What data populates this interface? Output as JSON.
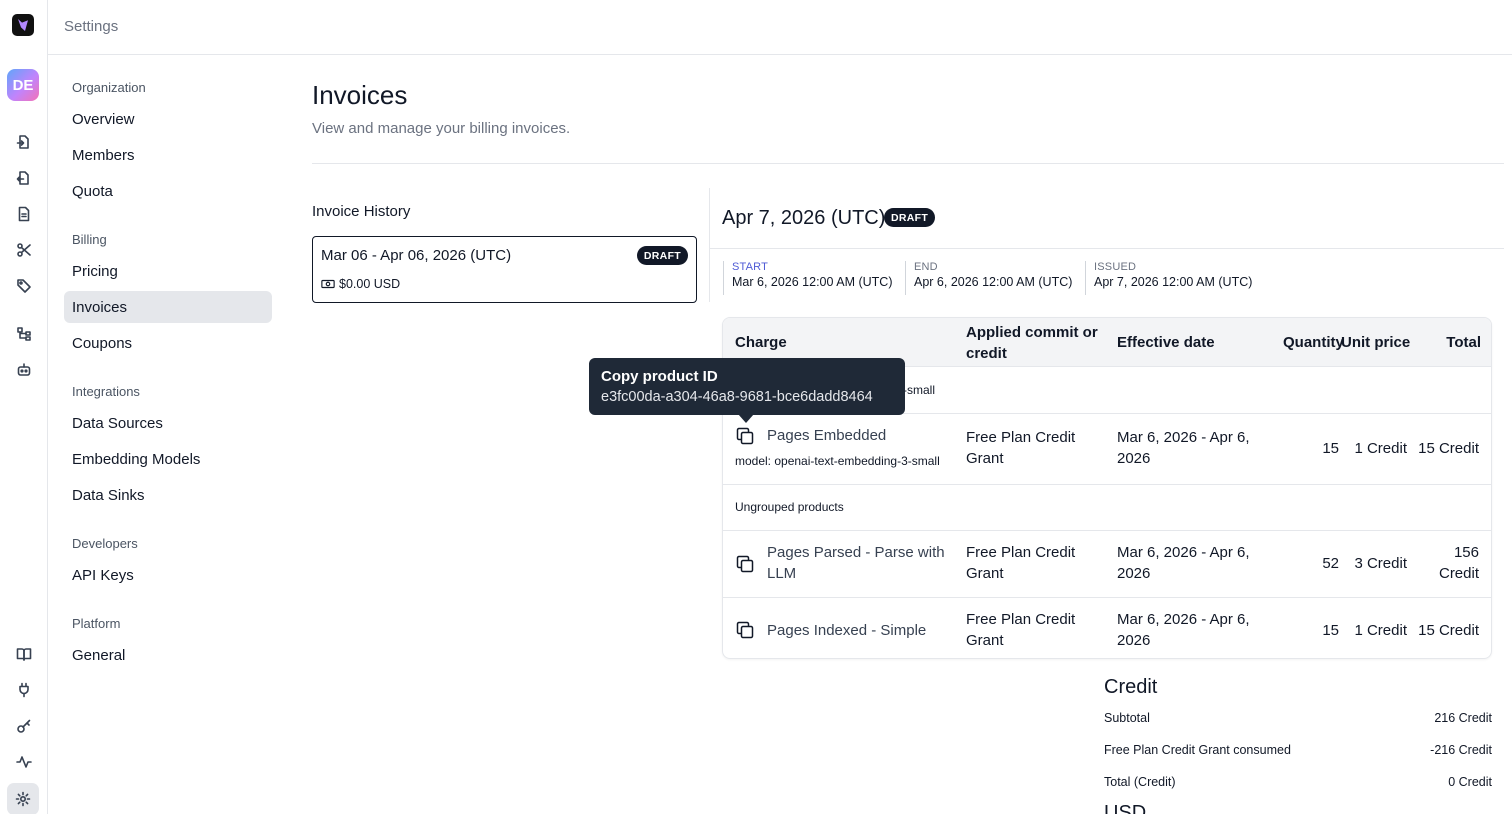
{
  "topbar": {
    "title": "Settings"
  },
  "user": {
    "initials": "DE"
  },
  "nav": {
    "groups": [
      {
        "label": "Organization",
        "items": [
          "Overview",
          "Members",
          "Quota"
        ]
      },
      {
        "label": "Billing",
        "items": [
          "Pricing",
          "Invoices",
          "Coupons"
        ]
      },
      {
        "label": "Integrations",
        "items": [
          "Data Sources",
          "Embedding Models",
          "Data Sinks"
        ]
      },
      {
        "label": "Developers",
        "items": [
          "API Keys"
        ]
      },
      {
        "label": "Platform",
        "items": [
          "General"
        ]
      }
    ],
    "active_item": "Invoices"
  },
  "page": {
    "title": "Invoices",
    "subtitle": "View and manage your billing invoices."
  },
  "history": {
    "title": "Invoice History",
    "invoices": [
      {
        "range": "Mar 06 - Apr 06, 2026 (UTC)",
        "badge": "DRAFT",
        "amount": "$0.00 USD"
      }
    ]
  },
  "detail": {
    "title": "Apr 7, 2026 (UTC)",
    "badge": "DRAFT",
    "meta": [
      {
        "label": "START",
        "value": "Mar 6, 2026 12:00 AM (UTC)"
      },
      {
        "label": "END",
        "value": "Apr 6, 2026 12:00 AM (UTC)"
      },
      {
        "label": "ISSUED",
        "value": "Apr 7, 2026 12:00 AM (UTC)"
      }
    ],
    "table": {
      "headers": {
        "charge": "Charge",
        "applied_line1": "Applied commit or",
        "applied_line2": "credit",
        "effective": "Effective date",
        "quantity": "Quantity",
        "unit_price": "Unit price",
        "total": "Total"
      },
      "group1_label_partial": "-small",
      "rows": [
        {
          "charge": "Pages Embedded",
          "model": "model: openai-text-embedding-3-small",
          "applied_line1": "Free Plan Credit",
          "applied_line2": "Grant",
          "effective_line1": "Mar 6, 2026 - Apr 6,",
          "effective_line2": "2026",
          "quantity": "15",
          "unit_price": "1 Credit",
          "total": "15 Credit"
        },
        {
          "charge_line1": "Pages Parsed - Parse with",
          "charge_line2": "LLM",
          "applied_line1": "Free Plan Credit",
          "applied_line2": "Grant",
          "effective_line1": "Mar 6, 2026 - Apr 6,",
          "effective_line2": "2026",
          "quantity": "52",
          "unit_price": "3 Credit",
          "total_line1": "156",
          "total_line2": "Credit"
        },
        {
          "charge": "Pages Indexed - Simple",
          "applied_line1": "Free Plan Credit",
          "applied_line2": "Grant",
          "effective_line1": "Mar 6, 2026 - Apr 6,",
          "effective_line2": "2026",
          "quantity": "15",
          "unit_price": "1 Credit",
          "total": "15 Credit"
        }
      ],
      "group2_label": "Ungrouped products"
    },
    "tooltip": {
      "title": "Copy product ID",
      "value": "e3fc00da-a304-46a8-9681-bce6dadd8464"
    },
    "summary": {
      "title": "Credit",
      "subtotal_label": "Subtotal",
      "subtotal_value": "216 Credit",
      "consumed_label": "Free Plan Credit Grant",
      "consumed_suffix": "consumed",
      "consumed_value": "-216 Credit",
      "total_label": "Total (Credit)",
      "total_value": "0 Credit",
      "next_section": "USD"
    }
  }
}
